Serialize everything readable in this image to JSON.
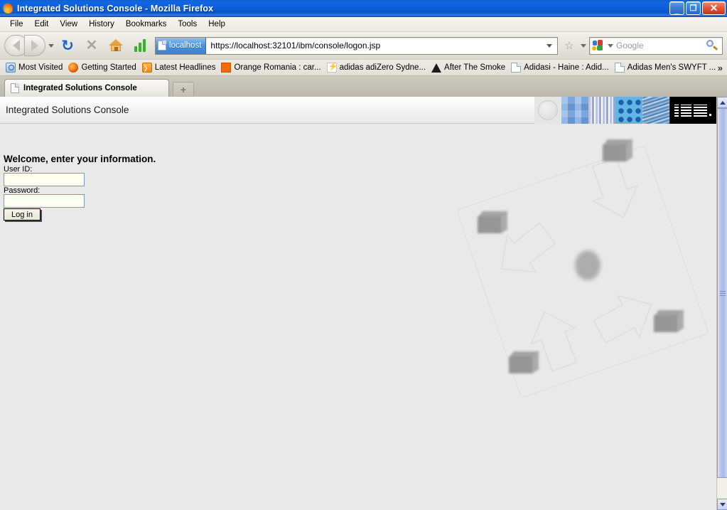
{
  "window": {
    "title": "Integrated Solutions Console - Mozilla Firefox",
    "app_icon": "firefox-icon",
    "controls": {
      "minimize": "_",
      "restore": "❐",
      "close": "✕"
    }
  },
  "menubar": {
    "items": [
      {
        "label": "File"
      },
      {
        "label": "Edit"
      },
      {
        "label": "View"
      },
      {
        "label": "History"
      },
      {
        "label": "Bookmarks"
      },
      {
        "label": "Tools"
      },
      {
        "label": "Help"
      }
    ]
  },
  "toolbar": {
    "back_icon": "back-arrow-icon",
    "forward_icon": "forward-arrow-icon",
    "reload_icon": "reload-icon",
    "reload_glyph": "↻",
    "stop_icon": "stop-icon",
    "stop_glyph": "✕",
    "home_icon": "home-icon",
    "chart_icon": "bar-chart-icon",
    "star_glyph": "☆",
    "identity_label": "localhost",
    "url": "https://localhost:32101/ibm/console/logon.jsp",
    "search_placeholder": "Google",
    "search_engine_icon": "google-icon",
    "magnifier_icon": "magnifier-icon"
  },
  "bookmarks": {
    "items": [
      {
        "label": "Most Visited",
        "icon": "most-visited-icon"
      },
      {
        "label": "Getting Started",
        "icon": "firefox-icon"
      },
      {
        "label": "Latest Headlines",
        "icon": "rss-feed-icon"
      },
      {
        "label": "Orange Romania : car...",
        "icon": "orange-favicon"
      },
      {
        "label": "adidas adiZero Sydne...",
        "icon": "adidas-favicon"
      },
      {
        "label": "After The Smoke",
        "icon": "triangle-favicon"
      },
      {
        "label": "Adidasi - Haine : Adid...",
        "icon": "page-favicon"
      },
      {
        "label": "Adidas Men's SWYFT ...",
        "icon": "page-favicon"
      }
    ],
    "overflow_glyph": "»"
  },
  "tabs": {
    "items": [
      {
        "label": "Integrated Solutions Console",
        "icon": "page-icon",
        "active": true
      }
    ],
    "new_tab_glyph": "+"
  },
  "console": {
    "header_title": "Integrated Solutions Console",
    "banner_segments": [
      "grey-circle-tile",
      "blue-checkerboard-tile",
      "vertical-stripes-tile",
      "blue-dots-tile",
      "water-texture-tile"
    ],
    "logo_text": "IBM",
    "form": {
      "welcome": "Welcome, enter your information.",
      "userid_label": "User ID:",
      "userid_value": "",
      "password_label": "Password:",
      "password_value": "",
      "login_button": "Log in"
    },
    "watermark": {
      "description": "rotated-square-with-inward-arrows-and-servers",
      "arrow_count": 4,
      "server_count": 4
    }
  },
  "scrollbar": {
    "up_glyph": "▲",
    "down_glyph": "▼"
  },
  "colors": {
    "titlebar_blue": "#0f62dc",
    "close_red": "#c9321a",
    "page_background": "#e9e9e9",
    "input_background": "#fffff2",
    "accent_green": "#35b229",
    "ibm_black": "#000000"
  }
}
